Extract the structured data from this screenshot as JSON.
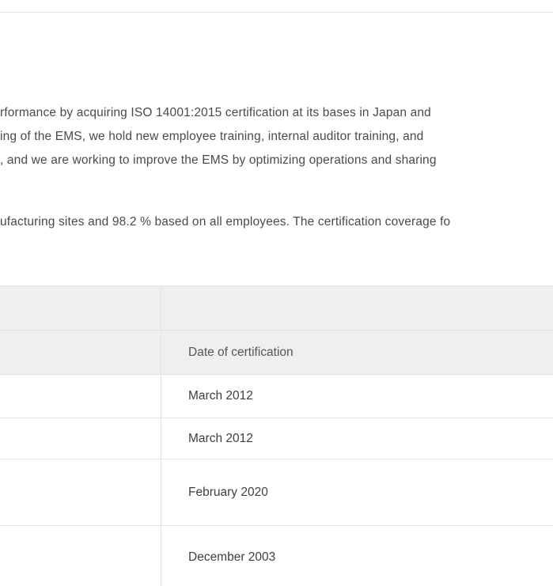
{
  "paragraph": {
    "line1": "rformance by acquiring ISO 14001:2015 certification at its bases in Japan and",
    "line2": "ing of the EMS, we hold new employee training, internal auditor training, and",
    "line3": ", and we are working to improve the EMS by optimizing operations and sharing",
    "line4": "ufacturing sites and 98.2 % based on all employees. The certification coverage fo"
  },
  "table": {
    "header_top_right": "",
    "header_right": "Date of certification",
    "rows": [
      {
        "date": "March 2012"
      },
      {
        "date": "March 2012"
      },
      {
        "date": "February 2020"
      },
      {
        "date": "December 2003"
      }
    ]
  }
}
